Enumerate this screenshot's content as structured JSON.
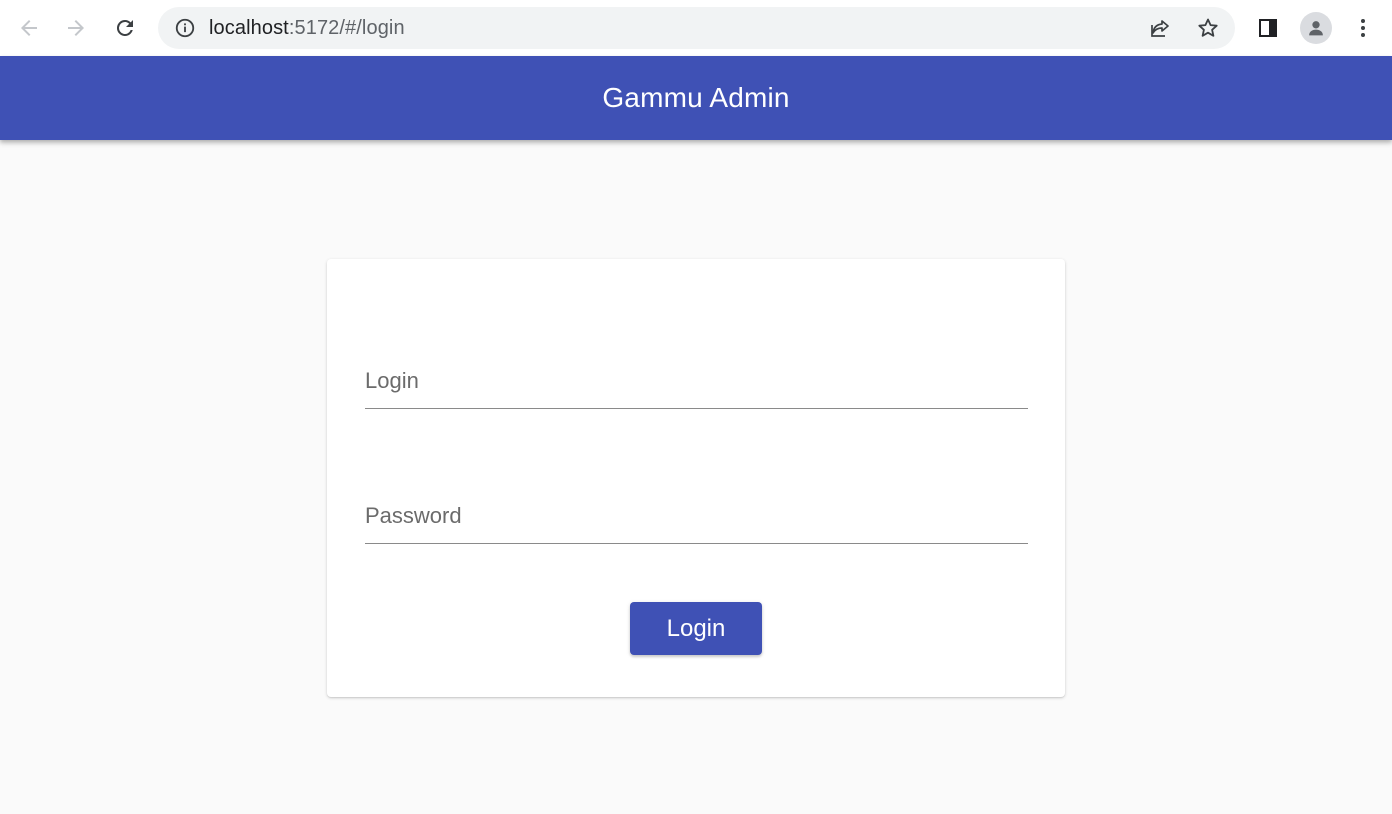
{
  "browser": {
    "url_host": "localhost",
    "url_path": ":5172/#/login"
  },
  "icons": {
    "back": "arrow-back-icon",
    "forward": "arrow-forward-icon",
    "reload": "reload-icon",
    "info": "info-icon",
    "share": "share-icon",
    "bookmark": "star-icon",
    "side_panel": "side-panel-icon",
    "profile": "profile-icon",
    "menu": "more-vert-icon"
  },
  "colors": {
    "primary": "#3f51b5",
    "background": "#fafafa"
  },
  "header": {
    "title": "Gammu Admin"
  },
  "form": {
    "login_label": "Login",
    "password_label": "Password",
    "submit_label": "Login"
  }
}
